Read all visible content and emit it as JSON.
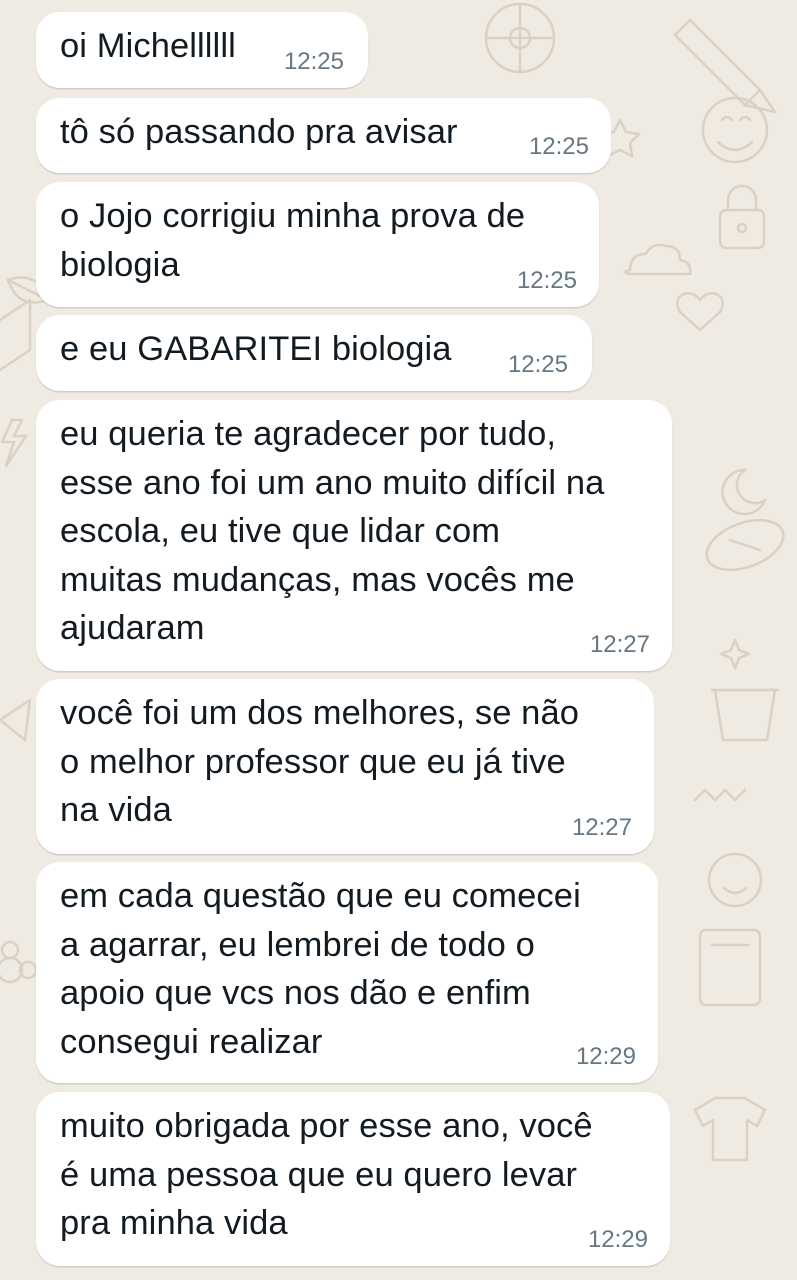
{
  "chat": {
    "messages": [
      {
        "text": "oi Michellllll",
        "time": "12:25"
      },
      {
        "text": "tô só passando pra avisar",
        "time": "12:25"
      },
      {
        "text": "o Jojo corrigiu minha prova de\nbiologia",
        "time": "12:25"
      },
      {
        "text": "e eu GABARITEI biologia",
        "time": "12:25"
      },
      {
        "text": "eu queria te agradecer por tudo,\nesse ano foi um ano muito difícil na\nescola, eu tive que lidar com\nmuitas mudanças, mas vocês me\najudaram",
        "time": "12:27"
      },
      {
        "text": "você foi um dos melhores, se não\no melhor professor que eu já tive\nna vida",
        "time": "12:27"
      },
      {
        "text": "em cada questão que eu comecei\na agarrar, eu lembrei de todo o\napoio que vcs nos dão e enfim\nconsegui realizar",
        "time": "12:29"
      },
      {
        "text": "muito obrigada por esse ano, você\né uma pessoa que eu quero levar\npra minha vida",
        "time": "12:29"
      }
    ]
  },
  "colors": {
    "background": "#efeae2",
    "bubble": "#ffffff",
    "text": "#111b21",
    "timestamp": "#667781",
    "doodle": "#d9d1c4"
  }
}
